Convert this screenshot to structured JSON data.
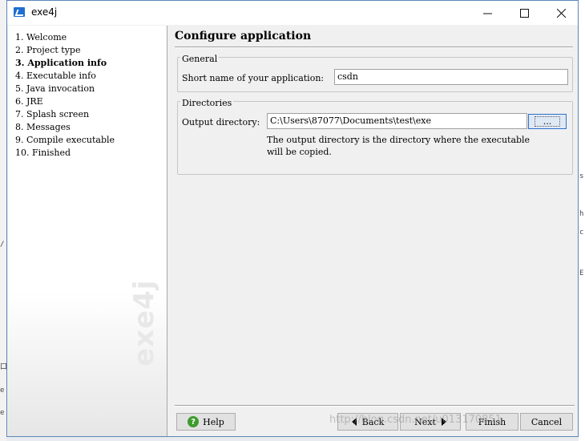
{
  "window": {
    "title": "exe4j"
  },
  "sidebar": {
    "steps": [
      "1. Welcome",
      "2. Project type",
      "3. Application info",
      "4. Executable info",
      "5. Java invocation",
      "6. JRE",
      "7. Splash screen",
      "8. Messages",
      "9. Compile executable",
      "10. Finished"
    ],
    "active_index": 2,
    "watermark": "exe4j"
  },
  "main": {
    "title": "Configure application",
    "general": {
      "label": "General",
      "short_name_label": "Short name of your application:",
      "short_name_value": "csdn"
    },
    "directories": {
      "label": "Directories",
      "output_label": "Output directory:",
      "output_value": "C:\\Users\\87077\\Documents\\test\\exe",
      "browse_label": "...",
      "help_text": "The output directory is the directory where the executable\nwill be copied."
    }
  },
  "footer": {
    "help": "Help",
    "back": "Back",
    "next": "Next",
    "finish": "Finish",
    "cancel": "Cancel"
  },
  "background": {
    "url_watermark": "http://blog.csdn.net/u013170851"
  },
  "colors": {
    "accent": "#2f6ecc",
    "help_green": "#3e9b2e",
    "title_bar": "#ffffff"
  }
}
